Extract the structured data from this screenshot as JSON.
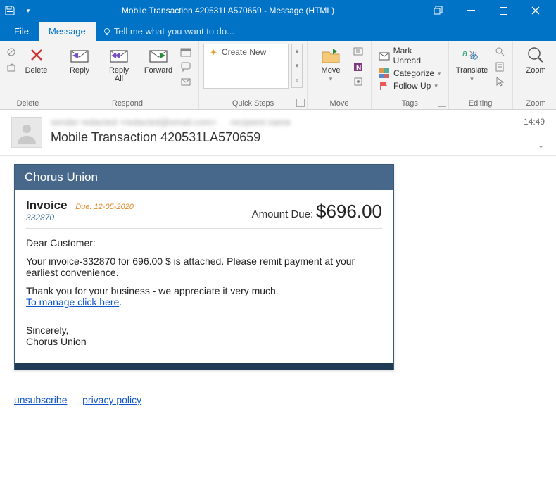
{
  "window": {
    "title": "Mobile Transaction 420531LA570659 - Message (HTML)"
  },
  "tabs": {
    "file": "File",
    "message": "Message",
    "tellme": "Tell me what you want to do..."
  },
  "ribbon": {
    "delete": {
      "label": "Delete",
      "group": "Delete"
    },
    "respond": {
      "group": "Respond",
      "reply": "Reply",
      "replyAll": "Reply\nAll",
      "forward": "Forward"
    },
    "quicksteps": {
      "group": "Quick Steps",
      "createNew": "Create New"
    },
    "move": {
      "group": "Move",
      "move": "Move"
    },
    "tags": {
      "group": "Tags",
      "markUnread": "Mark Unread",
      "categorize": "Categorize",
      "followUp": "Follow Up"
    },
    "editing": {
      "group": "Editing",
      "translate": "Translate"
    },
    "zoom": {
      "group": "Zoom",
      "zoom": "Zoom"
    }
  },
  "header": {
    "time": "14:49",
    "subject": "Mobile Transaction 420531LA570659"
  },
  "email": {
    "company": "Chorus Union",
    "invoiceLabel": "Invoice",
    "dueLabel": "Due: 12-05-2020",
    "invoiceNumber": "332870",
    "amountLabel": "Amount Due:",
    "amountValue": "$696.00",
    "greeting": "Dear Customer:",
    "line1": "Your invoice-332870 for 696.00 $ is attached. Please remit payment at your earliest convenience.",
    "line2": "Thank you for your business - we appreciate it very much.",
    "manageLink": "To manage click here",
    "signoff1": "Sincerely,",
    "signoff2": "Chorus Union",
    "unsubscribe": "unsubscribe",
    "privacy": "privacy policy"
  }
}
